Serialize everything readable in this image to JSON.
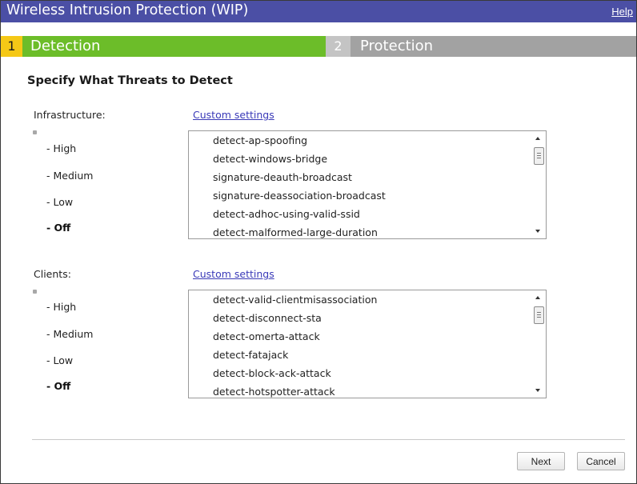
{
  "window": {
    "title": "Wireless Intrusion Protection (WIP)",
    "help_label": "Help"
  },
  "colors": {
    "title_bar": "#4b4fa5",
    "active_step_number": "#f5c816",
    "active_step": "#6cbd29",
    "inactive_step": "#a2a2a2",
    "link": "#3a3ab8"
  },
  "steps": [
    {
      "number": "1",
      "label": "Detection",
      "active": true
    },
    {
      "number": "2",
      "label": "Protection",
      "active": false
    }
  ],
  "heading": "Specify What Threats to Detect",
  "infrastructure": {
    "label": "Infrastructure:",
    "custom_settings_label": "Custom settings",
    "levels": [
      "- High",
      "- Medium",
      "- Low",
      "- Off"
    ],
    "selected_level": "- Off",
    "items": [
      "detect-ap-spoofing",
      "detect-windows-bridge",
      "signature-deauth-broadcast",
      "signature-deassociation-broadcast",
      "detect-adhoc-using-valid-ssid",
      "detect-malformed-large-duration"
    ]
  },
  "clients": {
    "label": "Clients:",
    "custom_settings_label": "Custom settings",
    "levels": [
      "- High",
      "- Medium",
      "- Low",
      "- Off"
    ],
    "selected_level": "- Off",
    "items": [
      "detect-valid-clientmisassociation",
      "detect-disconnect-sta",
      "detect-omerta-attack",
      "detect-fatajack",
      "detect-block-ack-attack",
      "detect-hotspotter-attack"
    ]
  },
  "buttons": {
    "next_label": "Next",
    "cancel_label": "Cancel"
  }
}
